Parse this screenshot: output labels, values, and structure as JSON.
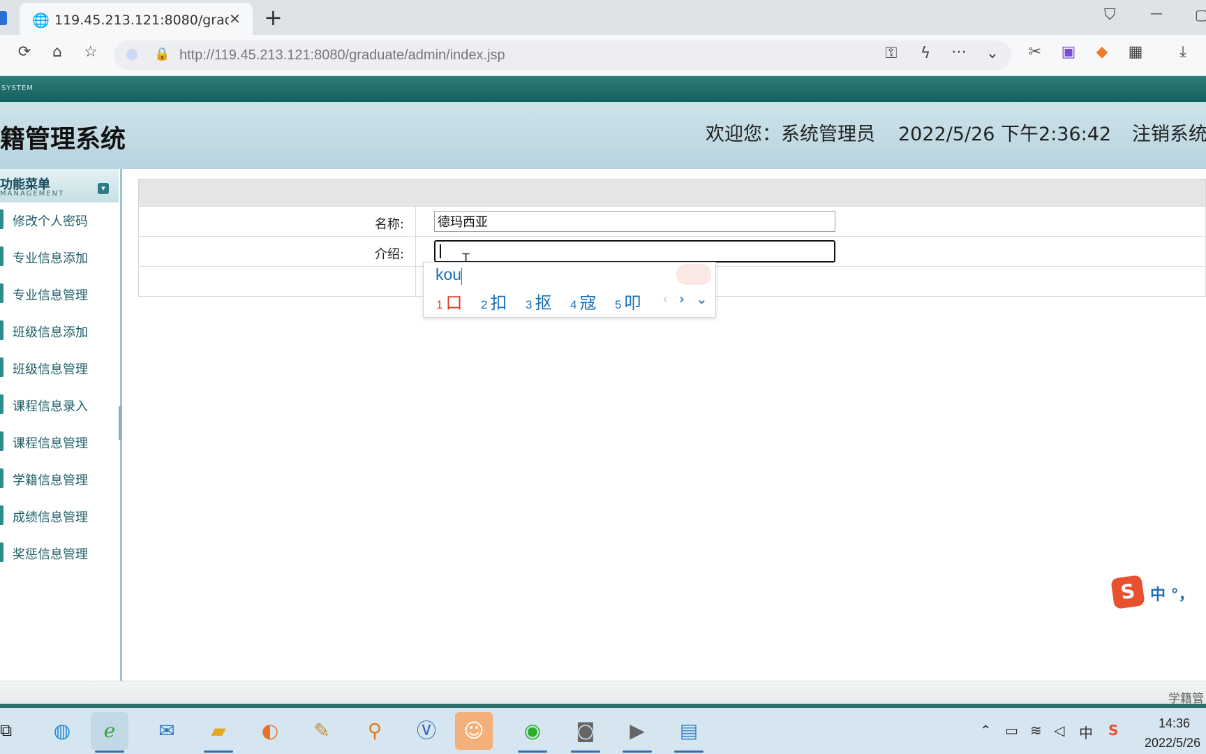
{
  "browser": {
    "tab_title": "119.45.213.121:8080/gradua",
    "url": "http://119.45.213.121:8080/graduate/admin/index.jsp",
    "new_tab_glyph": "+",
    "window_controls": {
      "minimize": "—",
      "maximize": "▢",
      "shirt": "👕"
    }
  },
  "app": {
    "top_strip": "SYSTEM",
    "title": "籍管理系统",
    "welcome": "欢迎您：系统管理员",
    "datetime": "2022/5/26 下午2:36:42",
    "logout": "注销系统",
    "footer_text": "学籍管"
  },
  "sidebar": {
    "heading": "功能菜单",
    "subheading": "MANAGEMENT",
    "toggle_glyph": "¥",
    "items": [
      {
        "label": "修改个人密码"
      },
      {
        "label": "专业信息添加"
      },
      {
        "label": "专业信息管理"
      },
      {
        "label": "班级信息添加"
      },
      {
        "label": "班级信息管理"
      },
      {
        "label": "课程信息录入"
      },
      {
        "label": "课程信息管理"
      },
      {
        "label": "学籍信息管理"
      },
      {
        "label": "成绩信息管理"
      },
      {
        "label": "奖惩信息管理"
      }
    ]
  },
  "form": {
    "name_label": "名称:",
    "name_value": "德玛西亚",
    "intro_label": "介绍:",
    "intro_value": ""
  },
  "ime": {
    "pinyin": "kou",
    "candidates": [
      {
        "num": "1",
        "char": "口"
      },
      {
        "num": "2",
        "char": "扣"
      },
      {
        "num": "3",
        "char": "抠"
      },
      {
        "num": "4",
        "char": "寇"
      },
      {
        "num": "5",
        "char": "叩"
      }
    ],
    "prev": "‹",
    "next": "›",
    "expand": "⌄",
    "status_logo": "S",
    "status_text": "中 °，"
  },
  "taskbar": {
    "time": "14:36",
    "date": "2022/5/26",
    "tray_lang": "中"
  },
  "colors": {
    "header_teal": "#15605d",
    "header_light": "#b7d3de",
    "menu_text": "#1f5e68",
    "ime_blue": "#1a6fb4",
    "ime_selected": "#e0391f",
    "sogou_orange": "#e8512e"
  }
}
